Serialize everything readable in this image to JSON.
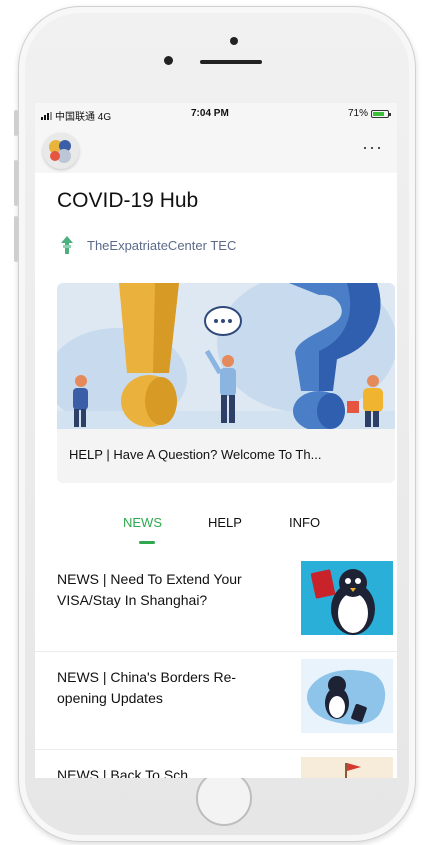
{
  "status_bar": {
    "carrier": "中国联通 4G",
    "time": "7:04 PM",
    "battery": "71%"
  },
  "app": {
    "more_label": "···"
  },
  "page": {
    "title": "COVID-19 Hub",
    "author": "TheExpatriateCenter TEC"
  },
  "featured": {
    "caption": "HELP | Have A Question? Welcome To Th..."
  },
  "tabs": [
    {
      "label": "NEWS"
    },
    {
      "label": "HELP"
    },
    {
      "label": "INFO"
    }
  ],
  "news": [
    {
      "title": "NEWS | Need To Extend Your VISA/Stay In Shanghai?"
    },
    {
      "title": "NEWS | China's Borders Re-opening Updates"
    },
    {
      "title": "NEWS | Back To Sch..."
    }
  ],
  "colors": {
    "accent": "#2fa84f",
    "scroll_indicator": "#3a9aa5"
  }
}
